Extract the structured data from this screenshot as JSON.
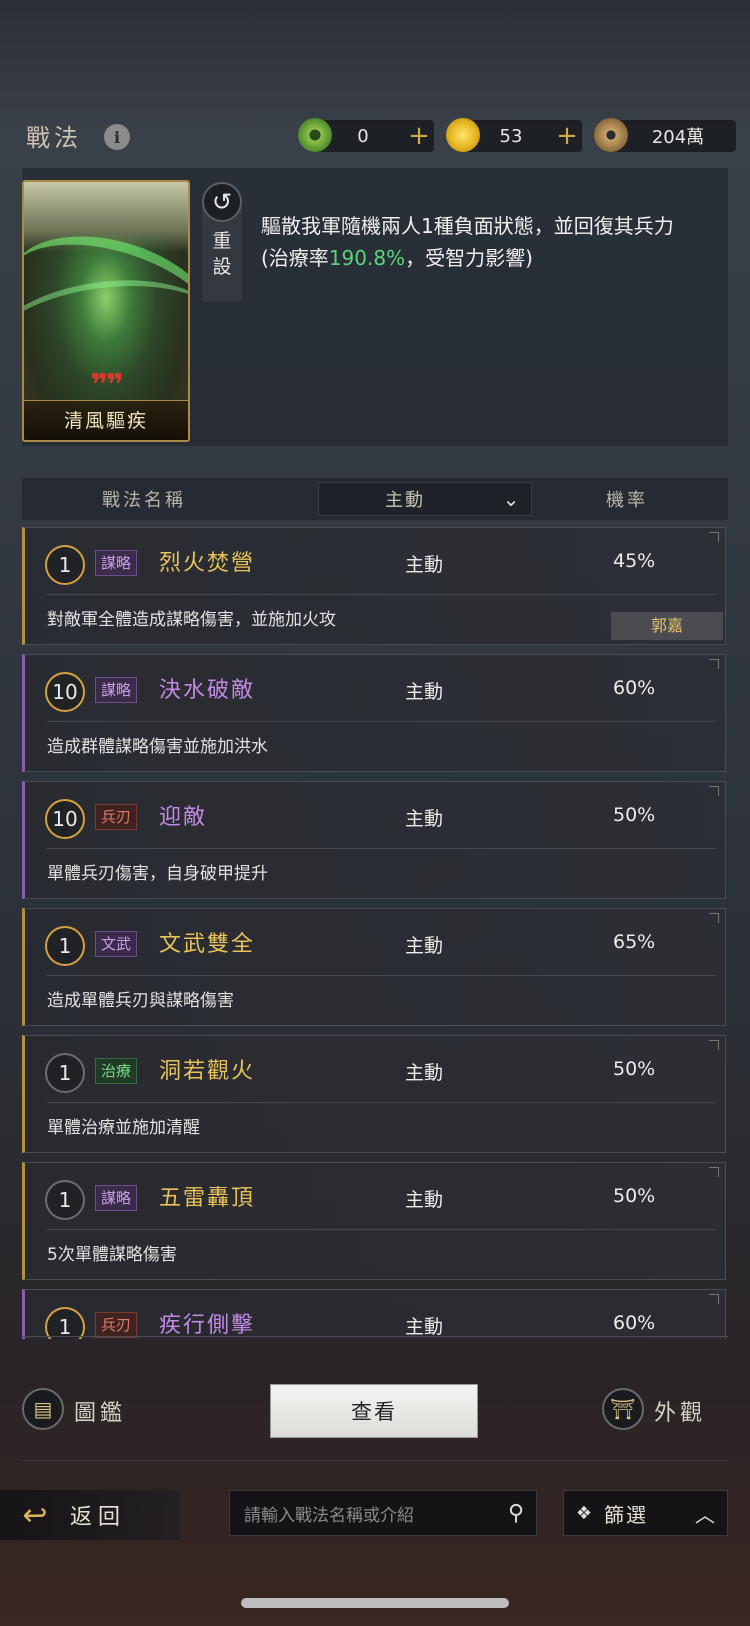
{
  "header": {
    "title": "戰法",
    "info_icon": "i",
    "resources": [
      {
        "icon": "jade-coin-icon",
        "value": "0",
        "plus": "+"
      },
      {
        "icon": "gold-coin-icon",
        "value": "53",
        "plus": "+"
      },
      {
        "icon": "copper-coin-icon",
        "value": "204萬"
      }
    ]
  },
  "skill_detail": {
    "card_name": "清風驅疾",
    "card_quote": "❞❞",
    "reset_label": "重設",
    "desc_part1": "驅散我軍隨機兩人1種負面狀態，並回復其兵力(治療率",
    "desc_highlight": "190.8%",
    "desc_part2": "，受智力影響)"
  },
  "table_header": {
    "name_col": "戰法名稱",
    "filter_value": "主動",
    "rate_col": "機率"
  },
  "skills": [
    {
      "level": "1",
      "tag": "謀略",
      "name": "烈火焚營",
      "type": "主動",
      "rate": "45%",
      "desc": "對敵軍全體造成謀略傷害，並施加火攻",
      "owner": "郭嘉"
    },
    {
      "level": "10",
      "tag": "謀略",
      "name": "決水破敵",
      "type": "主動",
      "rate": "60%",
      "desc": "造成群體謀略傷害並施加洪水"
    },
    {
      "level": "10",
      "tag": "兵刃",
      "name": "迎敵",
      "type": "主動",
      "rate": "50%",
      "desc": "單體兵刃傷害，自身破甲提升"
    },
    {
      "level": "1",
      "tag": "文武",
      "name": "文武雙全",
      "type": "主動",
      "rate": "65%",
      "desc": "造成單體兵刃與謀略傷害"
    },
    {
      "level": "1",
      "tag": "治療",
      "name": "洞若觀火",
      "type": "主動",
      "rate": "50%",
      "desc": "單體治療並施加清醒"
    },
    {
      "level": "1",
      "tag": "謀略",
      "name": "五雷轟頂",
      "type": "主動",
      "rate": "50%",
      "desc": "5次單體謀略傷害"
    },
    {
      "level": "1",
      "tag": "兵刃",
      "name": "疾行側擊",
      "type": "主動",
      "rate": "60%"
    }
  ],
  "bottom": {
    "codex_label": "圖鑑",
    "view_label": "查看",
    "appearance_label": "外觀",
    "back_label": "返回",
    "search_placeholder": "請輸入戰法名稱或介紹",
    "filter_label": "篩選"
  },
  "colors": {
    "accent_gold": "#b3923f",
    "accent_purple": "#8a5fb0",
    "heal_green": "#5bd47a"
  }
}
